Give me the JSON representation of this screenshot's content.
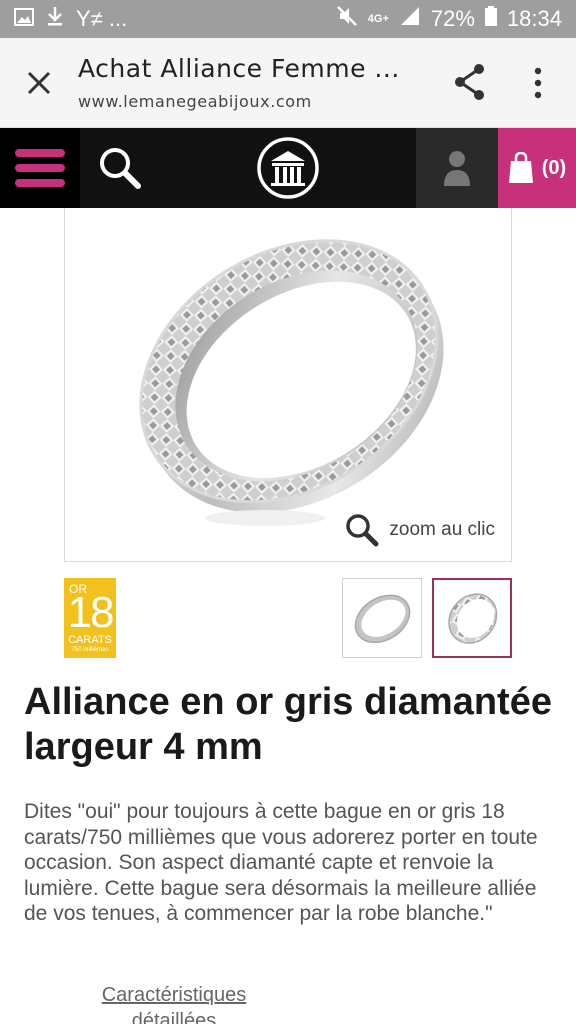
{
  "status_bar": {
    "notif_text": "Y≠ ...",
    "network": "4G+",
    "battery": "72%",
    "time": "18:34"
  },
  "custom_tab": {
    "title": "Achat Alliance Femme ...",
    "url": "www.lemanegeabijoux.com"
  },
  "site_nav": {
    "cart_count": "(0)",
    "accent_color": "#c7307a"
  },
  "product": {
    "zoom_label": "zoom au clic",
    "badge": {
      "or": "OR",
      "number": "18",
      "carats": "CARATS",
      "millesimes": "750 millièmes"
    },
    "title": "Alliance en or gris diamantée largeur 4 mm",
    "description": "Dites \"oui\" pour toujours à cette bague en or gris 18 carats/750 millièmes que vous adorerez porter en toute occasion. Son aspect diamanté capte et renvoie la lumière. Cette bague sera désormais la meilleure alliée de vos tenues, à commencer par la robe blanche.\"",
    "details_link": "Caractéristiques détaillées"
  }
}
